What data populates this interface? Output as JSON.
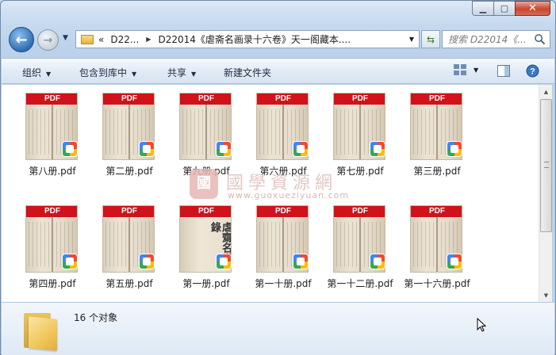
{
  "window": {
    "minimize_label": "▁",
    "maximize_label": "▢",
    "close_label": "✕"
  },
  "nav": {
    "history_arrow": "▼",
    "breadcrumb_prefix": "«",
    "crumbs": [
      "D22...",
      "D22014《虐斋名画录十六卷》天一阁藏本...."
    ],
    "separator": "▶",
    "search_placeholder": "搜索 D22014《..."
  },
  "toolbar": {
    "organize": "组织",
    "include_library": "包含到库中",
    "share": "共享",
    "new_folder": "新建文件夹",
    "dropdown_glyph": "▼"
  },
  "files": [
    {
      "name": "第八册.pdf",
      "banner": "PDF",
      "cover": false
    },
    {
      "name": "第二册.pdf",
      "banner": "PDF",
      "cover": false
    },
    {
      "name": "第九册.pdf",
      "banner": "PDF",
      "cover": false
    },
    {
      "name": "第六册.pdf",
      "banner": "PDF",
      "cover": false
    },
    {
      "name": "第七册.pdf",
      "banner": "PDF",
      "cover": false
    },
    {
      "name": "第三册.pdf",
      "banner": "PDF",
      "cover": false
    },
    {
      "name": "第四册.pdf",
      "banner": "PDF",
      "cover": false
    },
    {
      "name": "第五册.pdf",
      "banner": "PDF",
      "cover": false
    },
    {
      "name": "第一册.pdf",
      "banner": "PDF",
      "cover": true,
      "cover_text": "虐齋名畫錄"
    },
    {
      "name": "第一十册.pdf",
      "banner": "PDF",
      "cover": false
    },
    {
      "name": "第一十二册.pdf",
      "banner": "PDF",
      "cover": false
    },
    {
      "name": "第一十六册.pdf",
      "banner": "PDF",
      "cover": false
    }
  ],
  "watermark": {
    "seal": "國",
    "title": "國學資源網",
    "url": "www.guoxueziyuan.com"
  },
  "details": {
    "count_text": "16 个对象"
  },
  "icons": {
    "back": "back-arrow-icon",
    "forward": "forward-arrow-icon",
    "refresh": "refresh-icon",
    "search": "search-icon",
    "view": "view-options-icon",
    "preview": "preview-pane-icon",
    "help": "help-icon"
  },
  "colors": {
    "pdf_banner": "#d0121b",
    "accent": "#2f6eb4"
  }
}
